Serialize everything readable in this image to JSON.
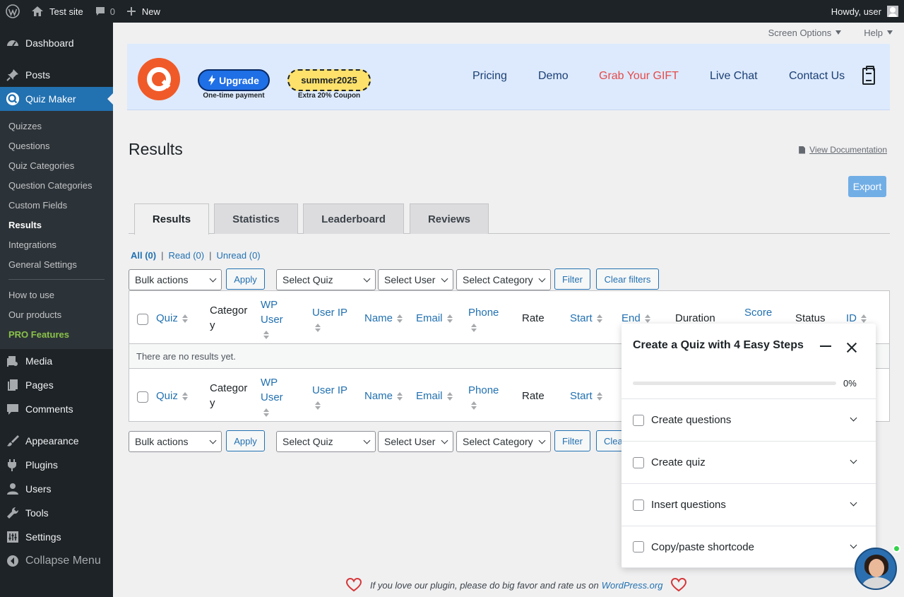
{
  "adminbar": {
    "site_name": "Test site",
    "comments_count": "0",
    "new_label": "New",
    "howdy": "Howdy, user"
  },
  "sidebar": {
    "dashboard": "Dashboard",
    "posts": "Posts",
    "quiz_maker": "Quiz Maker",
    "submenu": [
      "Quizzes",
      "Questions",
      "Quiz Categories",
      "Question Categories",
      "Custom Fields",
      "Results",
      "Integrations",
      "General Settings"
    ],
    "submenu2": [
      "How to use",
      "Our products"
    ],
    "pro": "PRO Features",
    "media": "Media",
    "pages": "Pages",
    "comments": "Comments",
    "appearance": "Appearance",
    "plugins": "Plugins",
    "users": "Users",
    "tools": "Tools",
    "settings": "Settings",
    "collapse": "Collapse Menu"
  },
  "screen_meta": {
    "screen_options": "Screen Options",
    "help": "Help"
  },
  "banner": {
    "upgrade": "Upgrade",
    "upgrade_caption": "One-time payment",
    "coupon": "summer2025",
    "coupon_caption": "Extra 20% Coupon",
    "links": [
      "Pricing",
      "Demo",
      "Grab Your GIFT",
      "Live Chat",
      "Contact Us"
    ]
  },
  "page": {
    "title": "Results",
    "view_doc": "View Documentation",
    "export": "Export"
  },
  "tabs": [
    "Results",
    "Statistics",
    "Leaderboard",
    "Reviews"
  ],
  "views": {
    "all": "All (0)",
    "read": "Read (0)",
    "unread": "Unread (0)",
    "sep": "|"
  },
  "filters": {
    "bulk_actions": "Bulk actions",
    "apply": "Apply",
    "select_quiz": "Select Quiz",
    "select_user": "Select User",
    "select_category": "Select Category",
    "filter": "Filter",
    "clear_filters": "Clear filters",
    "clear_partial": "Clea"
  },
  "table": {
    "columns": {
      "quiz": "Quiz",
      "category_a": "Categor",
      "category_b": "y",
      "wpuser_a": "WP",
      "wpuser_b": "User",
      "user_ip": "User IP",
      "name": "Name",
      "email": "Email",
      "phone": "Phone",
      "rate": "Rate",
      "start": "Start",
      "end": "End",
      "duration": "Duration",
      "score": "Score",
      "status": "Status",
      "id": "ID"
    },
    "empty": "There are no results yet."
  },
  "footer": {
    "text": "If you love our plugin, please do big favor and rate us on",
    "link": "WordPress.org"
  },
  "onboarding": {
    "title": "Create a Quiz with 4 Easy Steps",
    "progress_label": "0%",
    "progress_fraction": 0,
    "steps": [
      "Create questions",
      "Create quiz",
      "Insert questions",
      "Copy/paste shortcode"
    ]
  },
  "colors": {
    "accent": "#2271b1",
    "sidebar_bg": "#1d2327",
    "banner_bg": "#ddeafd",
    "gift": "#e34b4b",
    "pro": "#8ac249"
  }
}
